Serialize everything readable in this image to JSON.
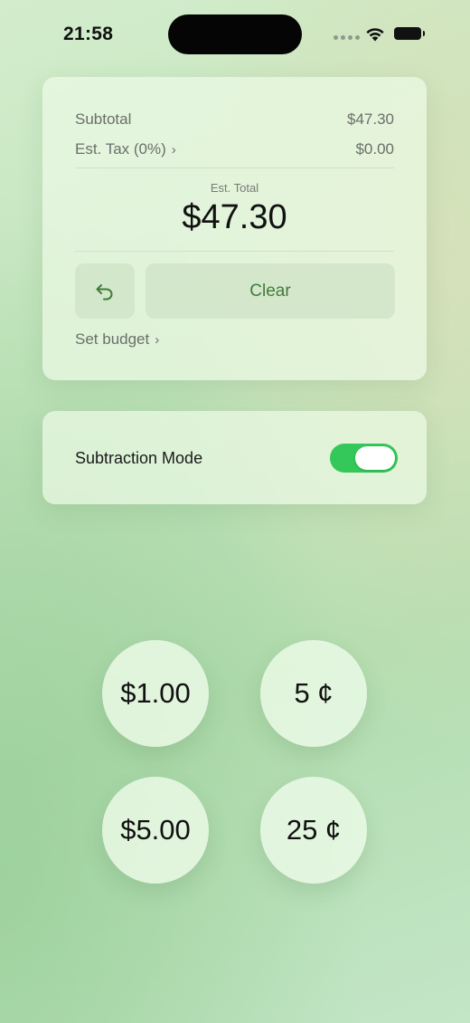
{
  "status_bar": {
    "time": "21:58"
  },
  "summary": {
    "subtotal_label": "Subtotal",
    "subtotal_value": "$47.30",
    "tax_label": "Est. Tax (0%)",
    "tax_value": "$0.00",
    "total_label": "Est. Total",
    "total_value": "$47.30",
    "clear_label": "Clear",
    "budget_label": "Set budget"
  },
  "mode": {
    "label": "Subtraction Mode",
    "enabled": true,
    "toggle_color": "#34c759"
  },
  "coins": [
    {
      "label": "$1.00"
    },
    {
      "label": "5 ¢"
    },
    {
      "label": "$5.00"
    },
    {
      "label": "25 ¢"
    }
  ],
  "colors": {
    "accent_text": "#3f7d3a",
    "background": "#c2e4bd"
  },
  "icons": {
    "undo": "undo-arrow-icon",
    "chevron": "chevron-right-icon",
    "wifi": "wifi-icon",
    "battery": "battery-icon"
  }
}
